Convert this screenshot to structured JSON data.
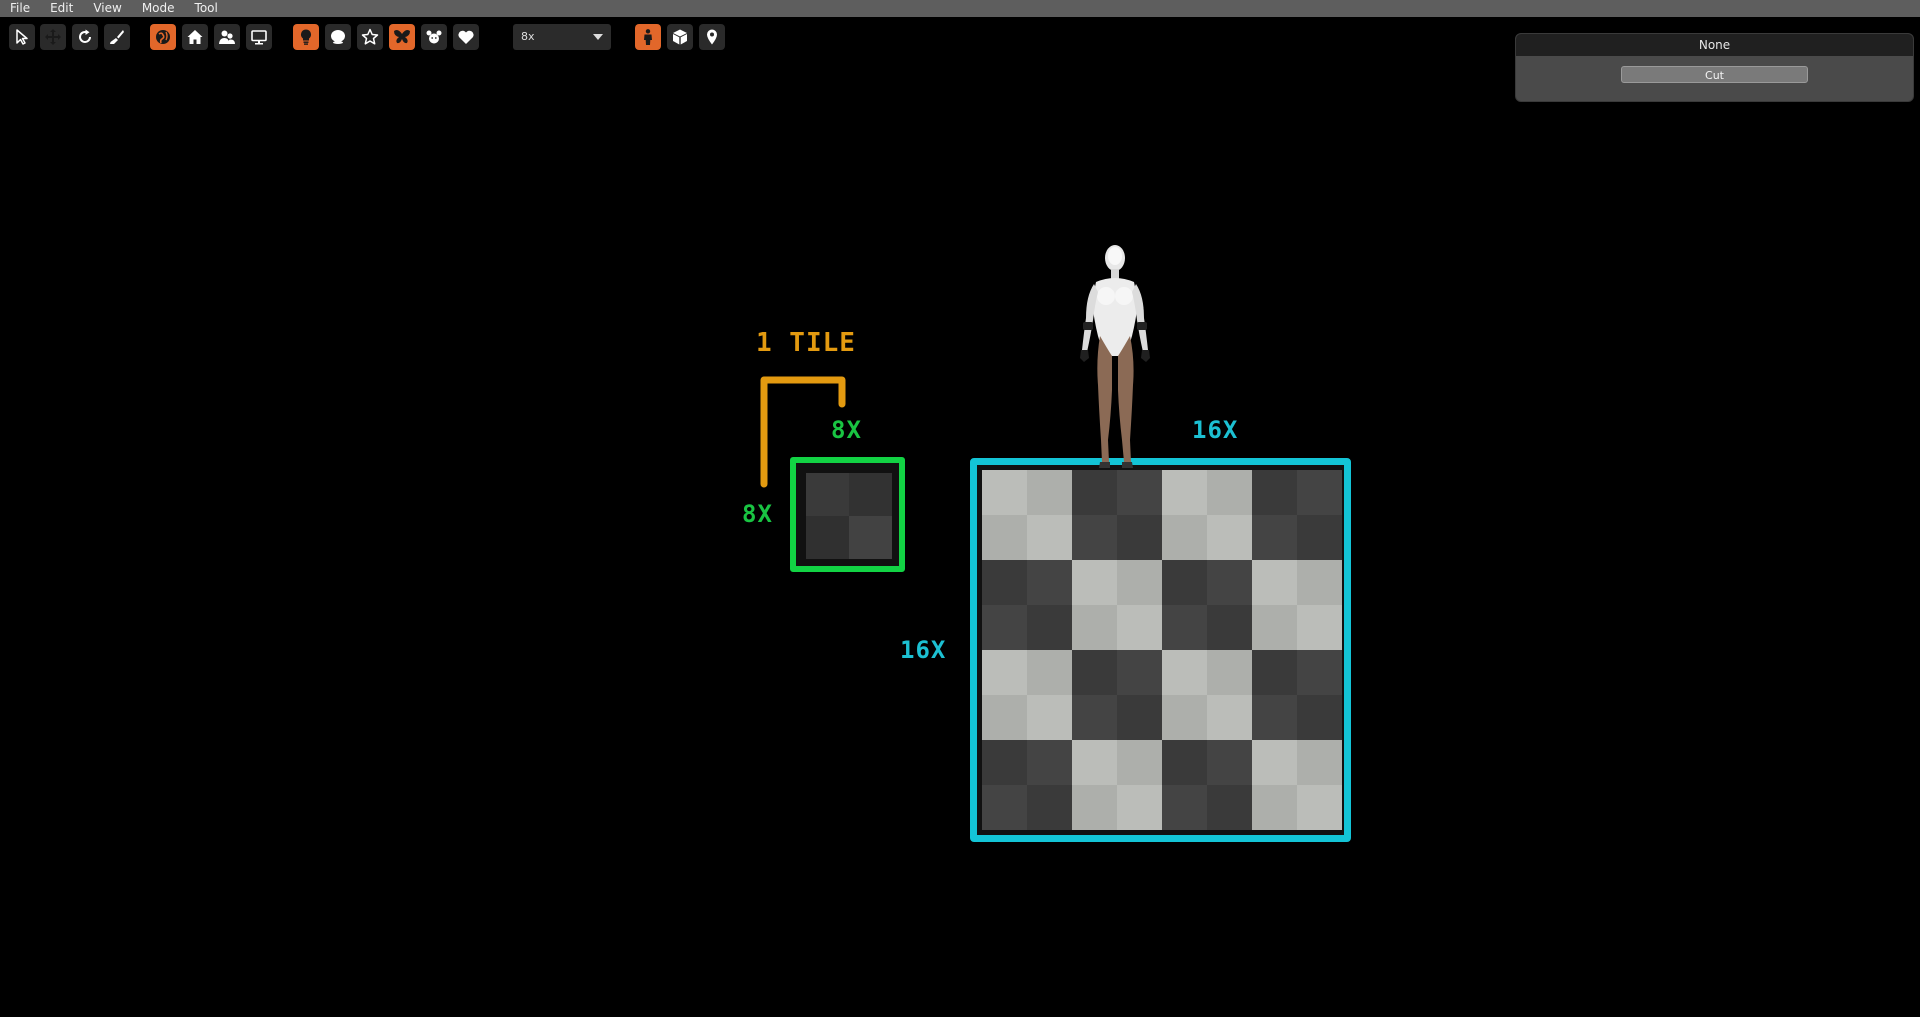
{
  "menu": [
    "File",
    "Edit",
    "View",
    "Mode",
    "Tool"
  ],
  "toolbar": {
    "groups": [
      [
        {
          "icon": "pointer-icon",
          "active": false
        },
        {
          "icon": "move-icon",
          "active": true
        },
        {
          "icon": "rotate-icon",
          "active": false
        },
        {
          "icon": "brush-icon",
          "active": false
        }
      ],
      [
        {
          "icon": "globe-icon",
          "active": true
        },
        {
          "icon": "home-icon",
          "active": false
        },
        {
          "icon": "people-icon",
          "active": false
        },
        {
          "icon": "monitor-icon",
          "active": false
        }
      ],
      [
        {
          "icon": "bulb-icon",
          "active": true
        },
        {
          "icon": "sphere-icon",
          "active": false
        },
        {
          "icon": "star-icon",
          "active": false
        },
        {
          "icon": "butterfly-icon",
          "active": true
        },
        {
          "icon": "paw-icon",
          "active": false
        },
        {
          "icon": "heart-icon",
          "active": false
        }
      ],
      [
        {
          "icon": "person-icon",
          "active": true
        },
        {
          "icon": "cube-icon",
          "active": false
        },
        {
          "icon": "map-pin-icon",
          "active": false
        }
      ]
    ],
    "zoom_value": "8x"
  },
  "panel": {
    "title": "None",
    "button_label": "Cut"
  },
  "viewport": {
    "tile_label": "1 TILE",
    "small_top_label": "8X",
    "small_left_label": "8X",
    "big_top_label": "16X",
    "big_left_label": "16X"
  },
  "colors": {
    "accent": "#e2672a",
    "tile_label": "#e39a10",
    "green": "#12d344",
    "cyan": "#13c4d6",
    "checker_light": "#bbbdb9",
    "checker_dark": "#3a3a3a"
  }
}
